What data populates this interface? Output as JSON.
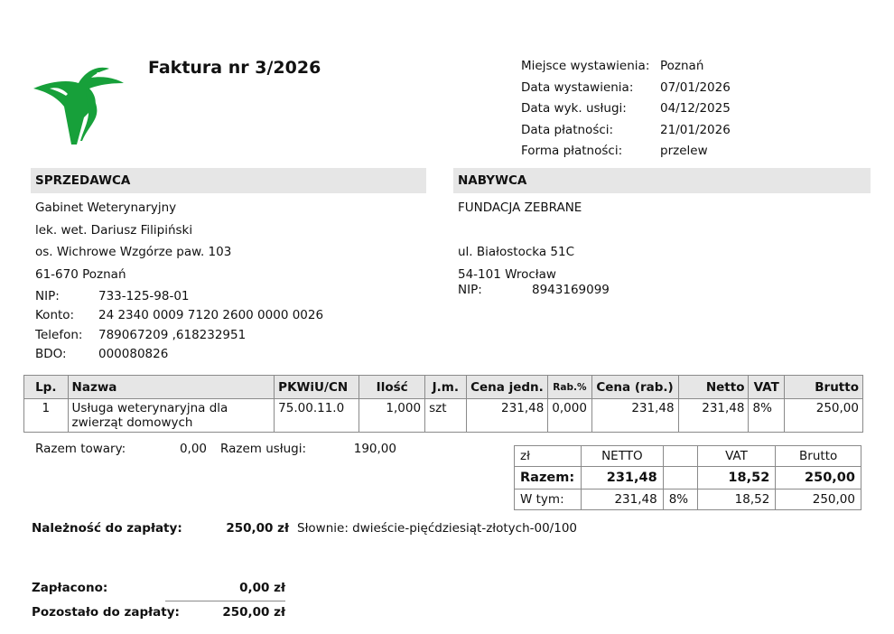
{
  "invoice": {
    "title": "Faktura nr 3/2026"
  },
  "meta": [
    {
      "label": "Miejsce wystawienia:",
      "value": "Poznań"
    },
    {
      "label": "Data wystawienia:",
      "value": "07/01/2026"
    },
    {
      "label": "Data wyk. usługi:",
      "value": "04/12/2025"
    },
    {
      "label": "Data płatności:",
      "value": "21/01/2026"
    },
    {
      "label": "Forma płatności:",
      "value": "przelew"
    }
  ],
  "seller": {
    "header": "SPRZEDAWCA",
    "lines": [
      "Gabinet Weterynaryjny",
      "lek. wet. Dariusz Filipiński",
      "os. Wichrowe Wzgórze paw. 103",
      "61-670 Poznań"
    ],
    "fields": [
      {
        "label": "NIP:",
        "value": "733-125-98-01"
      },
      {
        "label": "Konto:",
        "value": "24 2340 0009 7120 2600 0000 0026"
      },
      {
        "label": "Telefon:",
        "value": "789067209 ,618232951"
      },
      {
        "label": "BDO:",
        "value": "000080826"
      }
    ]
  },
  "buyer": {
    "header": "NABYWCA",
    "lines": [
      "FUNDACJA ZEBRANE",
      "",
      "ul. Białostocka 51C",
      "54-101 Wrocław"
    ],
    "nip_label": "NIP:",
    "nip": "8943169099"
  },
  "items_table": {
    "headers": [
      "Lp.",
      "Nazwa",
      "PKWiU/CN",
      "Ilość",
      "J.m.",
      "Cena jedn.",
      "Rab.%",
      "Cena (rab.)",
      "Netto",
      "VAT",
      "Brutto"
    ],
    "rows": [
      {
        "lp": "1",
        "name": "Usługa weterynaryjna dla zwierząt domowych",
        "pkwiu": "75.00.11.0",
        "qty": "1,000",
        "unit": "szt",
        "price": "231,48",
        "discount": "0,000",
        "price_disc": "231,48",
        "net": "231,48",
        "vat": "8%",
        "gross": "250,00"
      }
    ]
  },
  "totals_line": {
    "goods_label": "Razem towary:",
    "goods_value": "0,00",
    "services_label": "Razem usługi:",
    "services_value": "190,00"
  },
  "summary": {
    "head": {
      "currency": "zł",
      "net": "NETTO",
      "vat": "VAT",
      "gross": "Brutto"
    },
    "razem": {
      "label": "Razem:",
      "net": "231,48",
      "vat": "18,52",
      "gross": "250,00"
    },
    "wtym": {
      "label": "W tym:",
      "net": "231,48",
      "rate": "8%",
      "vat": "18,52",
      "gross": "250,00"
    }
  },
  "due": {
    "label": "Należność do zapłaty:",
    "amount": "250,00 zł",
    "words": "Słownie: dwieście-pięćdziesiąt-złotych-00/100"
  },
  "payment": {
    "paid_label": "Zapłacono:",
    "paid": "0,00 zł",
    "remaining_label": "Pozostało do zapłaty:",
    "remaining": "250,00 zł"
  },
  "colors": {
    "logo_green": "#17a03a",
    "band_gray": "#e6e6e6"
  }
}
